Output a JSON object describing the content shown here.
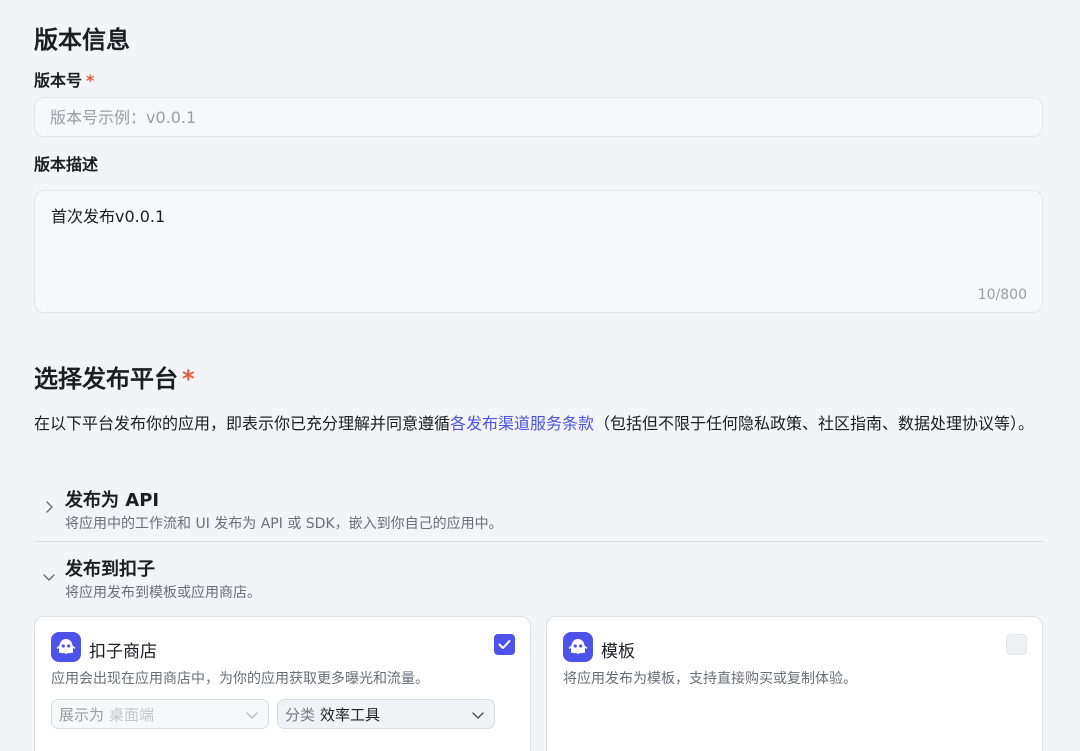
{
  "version_info": {
    "title": "版本信息",
    "version_label": "版本号",
    "required_mark": "*",
    "version_placeholder": "版本号示例：v0.0.1",
    "description_label": "版本描述",
    "description_value": "首次发布v0.0.1",
    "description_count": "10/800"
  },
  "platform": {
    "title": "选择发布平台",
    "required_mark": "*",
    "terms_before": "在以下平台发布你的应用，即表示你已充分理解并同意遵循",
    "terms_link": "各发布渠道服务条款",
    "terms_after": "（包括但不限于任何隐私政策、社区指南、数据处理协议等）。",
    "api": {
      "title": "发布为 API",
      "subtitle": "将应用中的工作流和 UI 发布为 API 或 SDK，嵌入到你自己的应用中。",
      "expanded": false
    },
    "coze": {
      "title": "发布到扣子",
      "subtitle": "将应用发布到模板或应用商店。",
      "expanded": true
    },
    "cards": {
      "store": {
        "name": "扣子商店",
        "desc": "应用会出现在应用商店中，为你的应用获取更多曝光和流量。",
        "checked": true,
        "display_prefix": "展示为",
        "display_value": "桌面端",
        "category_prefix": "分类",
        "category_value": "效率工具"
      },
      "template": {
        "name": "模板",
        "desc": "将应用发布为模板，支持直接购买或复制体验。",
        "checked": false
      }
    }
  },
  "colors": {
    "accent": "#4d53e8",
    "link": "#4b55d9",
    "required": "#e85a3c"
  }
}
